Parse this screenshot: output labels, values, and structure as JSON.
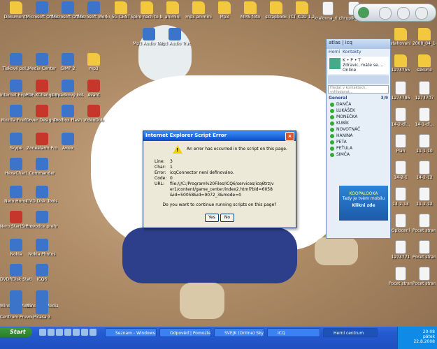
{
  "desktop": {
    "icons": [
      {
        "label": "Dokumenty",
        "kind": "folder"
      },
      {
        "label": "Microsoft Office W...",
        "kind": "app"
      },
      {
        "label": "Microsoft Office W...",
        "kind": "app"
      },
      {
        "label": "Microsoft Works",
        "kind": "app"
      },
      {
        "label": "5G CENT",
        "kind": "folder"
      },
      {
        "label": "Spiro nach to be?!!!!",
        "kind": "folder"
      },
      {
        "label": "animini",
        "kind": "folder"
      },
      {
        "label": "mp3 animini",
        "kind": "folder"
      },
      {
        "label": "Mp3",
        "kind": "folder"
      },
      {
        "label": "MMS foto",
        "kind": "folder"
      },
      {
        "label": "scrapbook",
        "kind": "folder"
      },
      {
        "label": "ICT KDD 1.2",
        "kind": "folder"
      },
      {
        "label": "kralovna_ri...",
        "kind": "doc"
      },
      {
        "label": "chrupik_mal...",
        "kind": "doc"
      },
      {
        "label": "Tiskové pol...",
        "kind": "app"
      },
      {
        "label": "Media Center",
        "kind": "app"
      },
      {
        "label": "GIMP 2",
        "kind": "app"
      },
      {
        "label": "mp3",
        "kind": "folder"
      },
      {
        "label": "Mp3 Audio Track",
        "kind": "app"
      },
      {
        "label": "Mp3 Audio Track",
        "kind": "app"
      },
      {
        "label": "Internet Explorer",
        "kind": "app"
      },
      {
        "label": "PDF-XChange Viewer",
        "kind": "red"
      },
      {
        "label": "Odpadkový koš",
        "kind": "app"
      },
      {
        "label": "Mozilla Firefox",
        "kind": "app"
      },
      {
        "label": "Cover Designer",
        "kind": "red"
      },
      {
        "label": "Toolbox Flash",
        "kind": "app"
      },
      {
        "label": "Avant",
        "kind": "red"
      },
      {
        "label": "VideoDub",
        "kind": "red"
      },
      {
        "label": "Skype",
        "kind": "app"
      },
      {
        "label": "Zonealarm Pro",
        "kind": "red"
      },
      {
        "label": "Aviex",
        "kind": "app"
      },
      {
        "label": "HexaChart",
        "kind": "app"
      },
      {
        "label": "Commander",
        "kind": "app"
      },
      {
        "label": "Nero Home",
        "kind": "app"
      },
      {
        "label": "DVD Disk Tools",
        "kind": "app"
      },
      {
        "label": "Nero StartSmart",
        "kind": "red"
      },
      {
        "label": "Pruvodce prehravani",
        "kind": "app"
      },
      {
        "label": "Nokia",
        "kind": "app"
      },
      {
        "label": "Nokia Photos",
        "kind": "app"
      },
      {
        "label": "DVDRDisk Station",
        "kind": "app"
      },
      {
        "label": "ICQ6",
        "kind": "app"
      },
      {
        "label": "Windows Media Player",
        "kind": "app"
      },
      {
        "label": "Windows Media Player",
        "kind": "app"
      },
      {
        "label": "Centrum Pruvodce",
        "kind": "app"
      },
      {
        "label": "Picasa 3",
        "kind": "app"
      }
    ],
    "right_icons": [
      {
        "label": "stahovani"
      },
      {
        "label": "2008_04_14"
      },
      {
        "label": "1274755"
      },
      {
        "label": "sakurie"
      },
      {
        "label": "1274786"
      },
      {
        "label": "1274707"
      },
      {
        "label": "14-2-dl..."
      },
      {
        "label": "14-1-dl..."
      },
      {
        "label": "Plan"
      },
      {
        "label": "11-1-10"
      },
      {
        "label": "14-2-1"
      },
      {
        "label": "14-2-12"
      },
      {
        "label": "14-2-13"
      },
      {
        "label": "11-2-12"
      },
      {
        "label": "Oplocení"
      },
      {
        "label": "Pocet strany"
      },
      {
        "label": "1274771"
      },
      {
        "label": "Pocet strany"
      },
      {
        "label": "Pocet strany 2"
      },
      {
        "label": "Pocet strany"
      }
    ]
  },
  "icq": {
    "brand": "atlas | icq",
    "tabs": [
      "Herní",
      "Kontakty"
    ],
    "nick": "K • P • T",
    "status_msg": "Zdravic, máte se....",
    "status": "Online",
    "search_placeholder": "Hledat v kontaktech, vyhledávat...",
    "group_name": "General",
    "group_count": "3/9",
    "contacts": [
      "DANČA",
      "LUKÁŠEK",
      "MONEČKA",
      "KUBÍK",
      "NOVOTNÁČ",
      "HANINA",
      "PETA",
      "PEŤULA",
      "SIMČA"
    ],
    "ad_text": "KOOPALOOKA",
    "ad_line2": "Tady je tvém mobilu",
    "ad_button": "Klikni zde"
  },
  "dialog": {
    "title": "Internet Explorer Script Error",
    "message": "An error has occurred in the script on this page.",
    "rows": [
      {
        "k": "Line:",
        "v": "3"
      },
      {
        "k": "Char:",
        "v": "1"
      },
      {
        "k": "Error:",
        "v": "icqConnector není definováno."
      },
      {
        "k": "Code:",
        "v": "0"
      },
      {
        "k": "URL:",
        "v": "file:///C:/Program%20Files/ICQ6/services/icq6trz/ver1/content/game_center/index2.html?bid=6058&id=50058&id=9072_3&mode=0"
      }
    ],
    "question": "Do you want to continue running scripts on this page?",
    "yes": "Yes",
    "no": "No",
    "close": "×"
  },
  "taskbar": {
    "start": "Start",
    "tasks": [
      {
        "label": "Seznam - Windows In..."
      },
      {
        "label": "Odpověď | Pomozte n..."
      },
      {
        "label": "SVEJK (Online) Skype..."
      },
      {
        "label": "ICQ"
      },
      {
        "label": "Herní centrum"
      }
    ],
    "clock_time": "20:08",
    "clock_day": "pátek",
    "clock_date": "22.8.2008"
  }
}
